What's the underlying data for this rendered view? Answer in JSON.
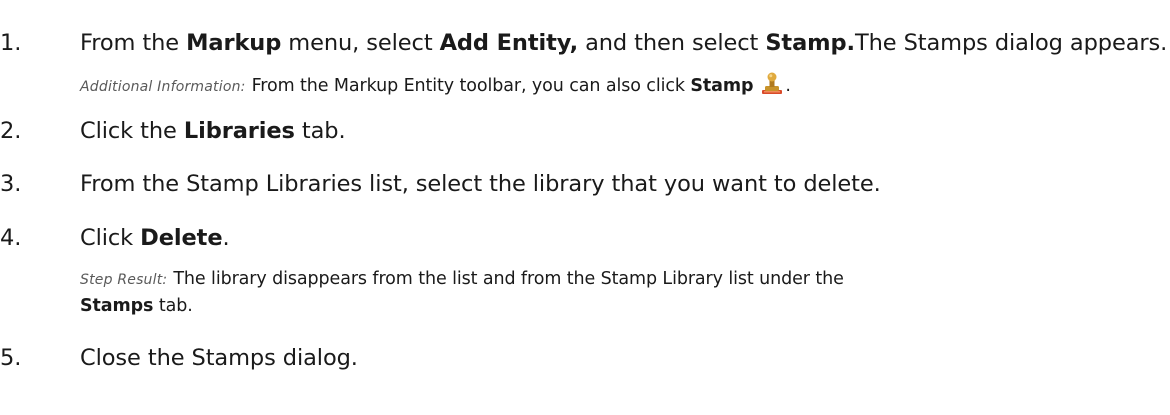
{
  "steps": [
    {
      "number": "1.",
      "t1": "From the ",
      "b1": "Markup",
      "t2": " menu, select ",
      "b2": "Add Entity,",
      "t3": " and then select ",
      "b3": "Stamp.",
      "t4": "The Stamps dialog appears.",
      "note": {
        "label": "Additional Information:",
        "t1": "From the Markup Entity toolbar, you can also click ",
        "b1": "Stamp",
        "t2": ".",
        "icon": "stamp-icon"
      }
    },
    {
      "number": "2.",
      "t1": "Click the ",
      "b1": "Libraries",
      "t2": " tab."
    },
    {
      "number": "3.",
      "t1": "From the Stamp Libraries list, select the library that you want to delete."
    },
    {
      "number": "4.",
      "t1": "Click ",
      "b1": "Delete",
      "t2": ".",
      "note": {
        "label": "Step Result:",
        "t1": "The library disappears from the list and from the Stamp Library list under the ",
        "b1": "Stamps",
        "t2": " tab."
      }
    },
    {
      "number": "5.",
      "t1": "Close the Stamps dialog."
    }
  ],
  "colors": {
    "text": "#1a1a1a",
    "label": "#5a5a5a",
    "stamp_handle": "#c8932a",
    "stamp_pad": "#d94a2a"
  }
}
